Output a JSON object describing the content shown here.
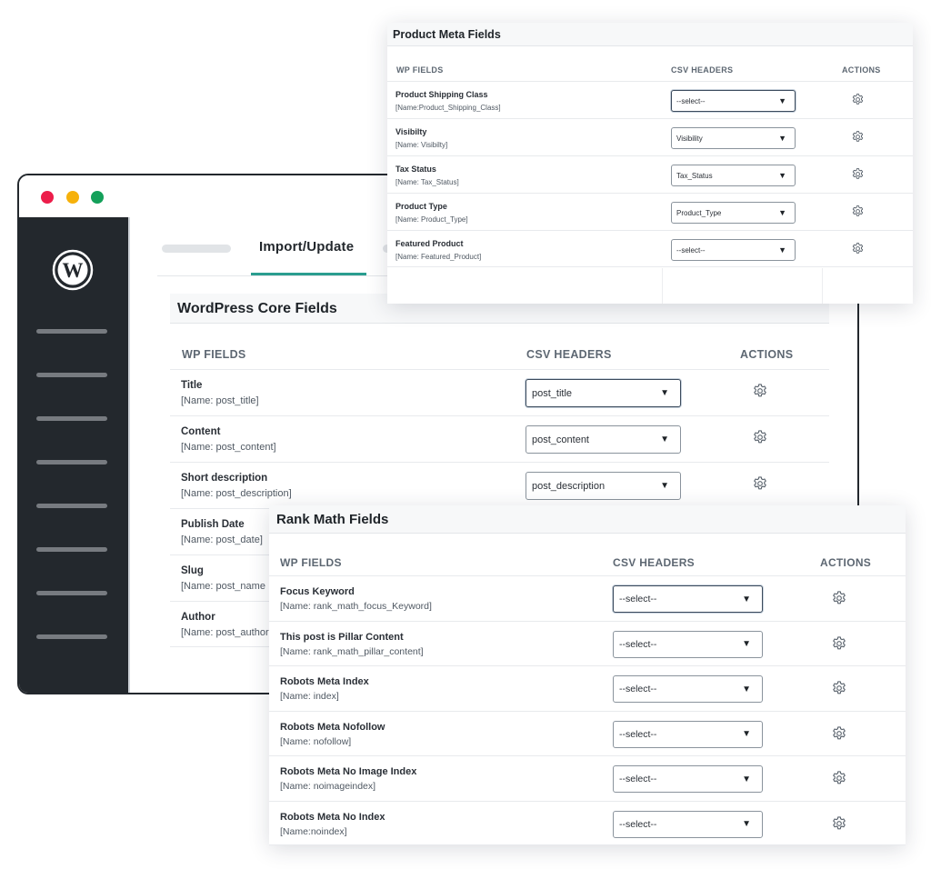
{
  "browser": {
    "tab_active": "Import/Update"
  },
  "core": {
    "title": "WordPress Core Fields",
    "headers": {
      "wp_fields": "WP FIELDS",
      "csv_headers": "CSV HEADERS",
      "actions": "ACTIONS"
    },
    "rows": [
      {
        "label": "Title",
        "name": "[Name: post_title]",
        "csv": "post_title"
      },
      {
        "label": "Content",
        "name": "[Name: post_content]",
        "csv": "post_content"
      },
      {
        "label": "Short description",
        "name": "[Name: post_description]",
        "csv": "post_description"
      },
      {
        "label": "Publish Date",
        "name": "[Name: post_date]"
      },
      {
        "label": "Slug",
        "name": "[Name: post_name"
      },
      {
        "label": "Author",
        "name": "[Name: post_author"
      }
    ]
  },
  "meta": {
    "title": "Product Meta Fields",
    "headers": {
      "wp_fields": "WP FIELDS",
      "csv_headers": "CSV HEADERS",
      "actions": "ACTIONS"
    },
    "rows": [
      {
        "label": "Product Shipping Class",
        "name": "[Name:Product_Shipping_Class]",
        "csv": "--select--"
      },
      {
        "label": "Visibilty",
        "name": "[Name: Visibilty]",
        "csv": "Visibility"
      },
      {
        "label": "Tax Status",
        "name": "[Name: Tax_Status]",
        "csv": "Tax_Status"
      },
      {
        "label": "Product Type",
        "name": "[Name: Product_Type]",
        "csv": "Product_Type"
      },
      {
        "label": "Featured Product",
        "name": "[Name: Featured_Product]",
        "csv": "--select--"
      }
    ]
  },
  "rank": {
    "title": "Rank Math Fields",
    "headers": {
      "wp_fields": "WP FIELDS",
      "csv_headers": "CSV HEADERS",
      "actions": "ACTIONS"
    },
    "rows": [
      {
        "label": "Focus Keyword",
        "name": "[Name: rank_math_focus_Keyword]",
        "csv": "--select--"
      },
      {
        "label": "This post is Pillar Content",
        "name": "[Name: rank_math_pillar_content]",
        "csv": "--select--"
      },
      {
        "label": "Robots Meta Index",
        "name": "[Name: index]",
        "csv": "--select--"
      },
      {
        "label": "Robots Meta Nofollow",
        "name": "[Name: nofollow]",
        "csv": "--select--"
      },
      {
        "label": "Robots Meta No Image Index",
        "name": "[Name: noimageindex]",
        "csv": "--select--"
      },
      {
        "label": "Robots Meta No Index",
        "name": "[Name:noindex]",
        "csv": "--select--"
      }
    ]
  },
  "icons": {
    "select_caret": "triangle-down-icon",
    "action": "gear-icon",
    "logo": "wordpress-logo"
  },
  "colors": {
    "sidebar": "#23282d",
    "accent": "#2a9d8f",
    "dot_red": "#ec1d4a",
    "dot_yellow": "#f6b10b",
    "dot_green": "#14a05a"
  }
}
